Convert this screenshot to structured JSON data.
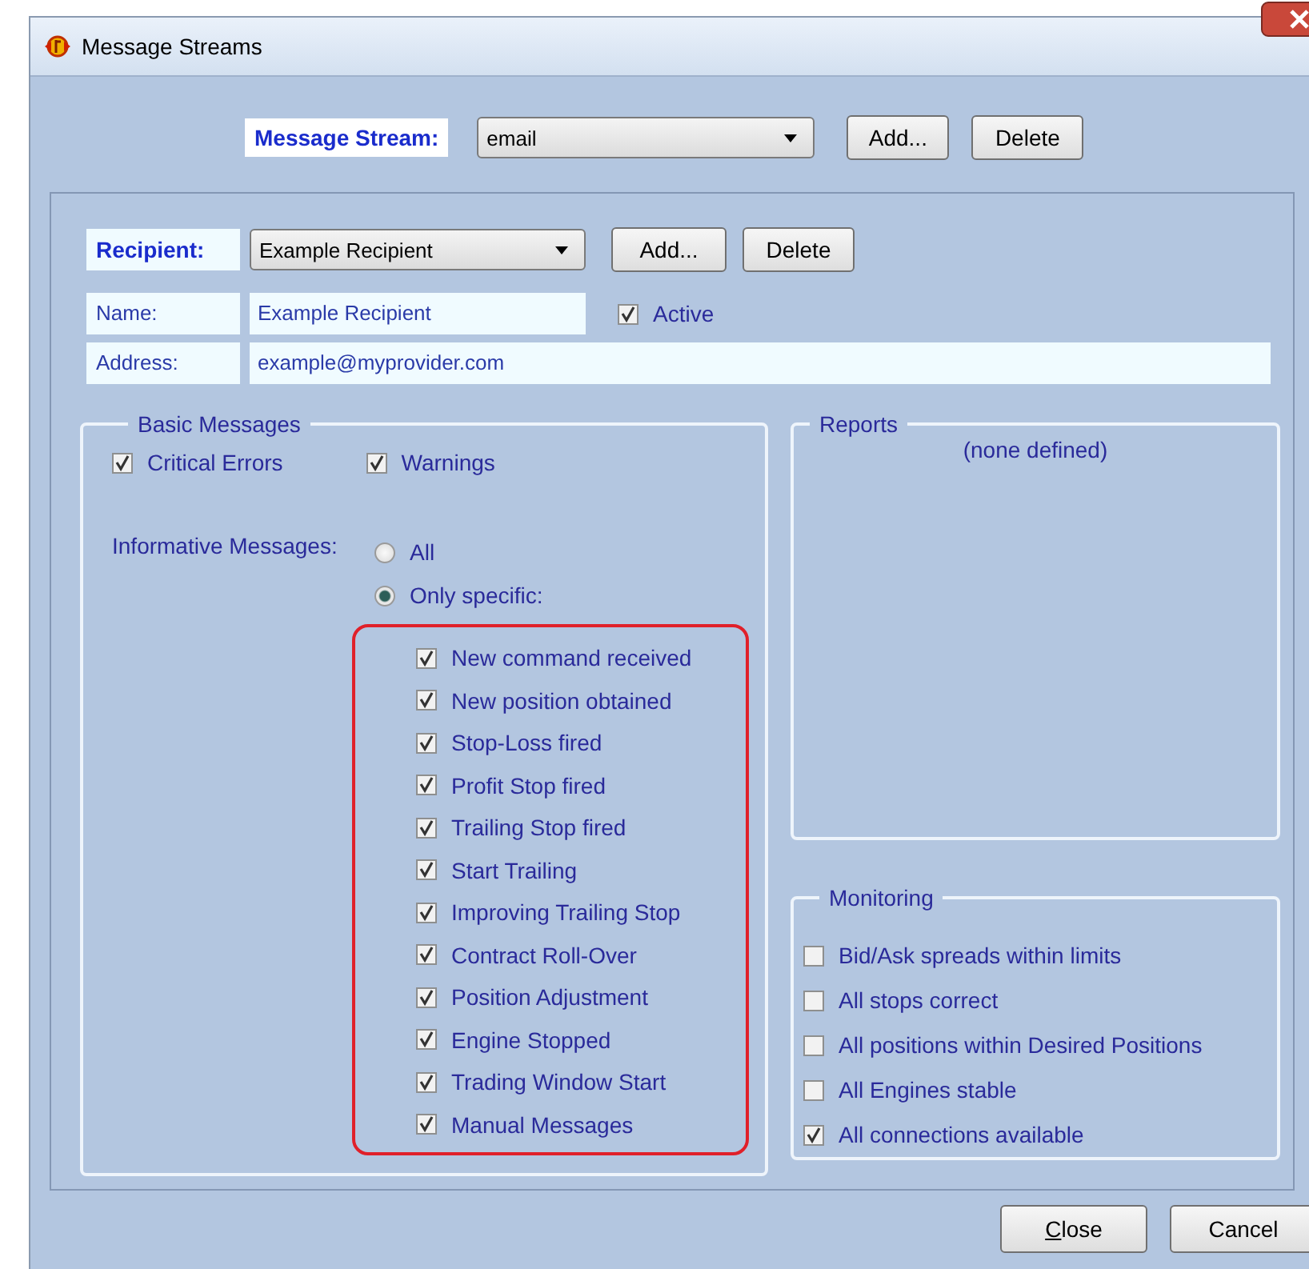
{
  "window": {
    "title": "Message Streams"
  },
  "message_stream": {
    "label": "Message Stream:",
    "value": "email",
    "buttons": [
      "Add...",
      "Delete"
    ]
  },
  "recipient": {
    "label": "Recipient:",
    "value": "Example Recipient",
    "buttons": [
      "Add...",
      "Delete"
    ]
  },
  "name": {
    "label": "Name:",
    "value": "Example Recipient"
  },
  "active": {
    "label": "Active",
    "checked": true
  },
  "address": {
    "label": "Address:",
    "value": "example@myprovider.com"
  },
  "basic_messages": {
    "title": "Basic Messages",
    "options": [
      {
        "label": "Critical Errors",
        "checked": true
      },
      {
        "label": "Warnings",
        "checked": true
      }
    ],
    "informative_label": "Informative Messages:",
    "modes": [
      {
        "label": "All",
        "selected": false
      },
      {
        "label": "Only specific:",
        "selected": true
      }
    ],
    "specific": [
      {
        "label": "New command received",
        "checked": true
      },
      {
        "label": "New position obtained",
        "checked": true
      },
      {
        "label": "Stop-Loss fired",
        "checked": true
      },
      {
        "label": "Profit Stop fired",
        "checked": true
      },
      {
        "label": "Trailing Stop fired",
        "checked": true
      },
      {
        "label": "Start Trailing",
        "checked": true
      },
      {
        "label": "Improving Trailing Stop",
        "checked": true
      },
      {
        "label": "Contract Roll-Over",
        "checked": true
      },
      {
        "label": "Position Adjustment",
        "checked": true
      },
      {
        "label": "Engine Stopped",
        "checked": true
      },
      {
        "label": "Trading Window Start",
        "checked": true
      },
      {
        "label": "Manual Messages",
        "checked": true
      }
    ]
  },
  "reports": {
    "title": "Reports",
    "empty_text": "(none defined)"
  },
  "monitoring": {
    "title": "Monitoring",
    "items": [
      {
        "label": "Bid/Ask spreads within limits",
        "checked": false
      },
      {
        "label": "All stops correct",
        "checked": false
      },
      {
        "label": "All positions within Desired Positions",
        "checked": false
      },
      {
        "label": "All Engines stable",
        "checked": false
      },
      {
        "label": "All connections available",
        "checked": true
      }
    ]
  },
  "buttons": [
    "Close",
    "Cancel"
  ]
}
